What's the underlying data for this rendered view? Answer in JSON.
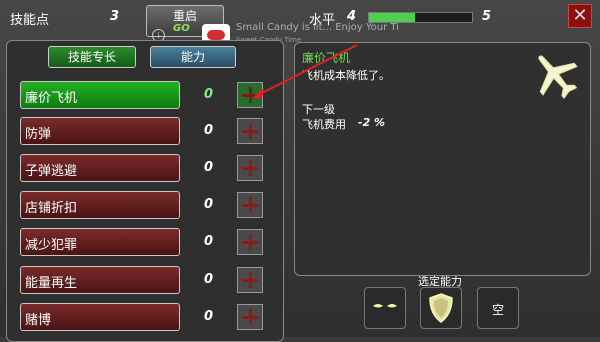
{
  "top": {
    "skill_points_label": "技能点",
    "skill_points": "3",
    "restart": "重启",
    "restart_sub": "GO",
    "level_label": "水平",
    "level": "4",
    "next_level": "5",
    "level_progress": 0.45
  },
  "ad": {
    "title": "Small Candy is lit... Enjoy Your Ti",
    "sub": "Sweet Candy Time",
    "info": "i"
  },
  "tabs": [
    "技能专长",
    "能力"
  ],
  "skills": [
    {
      "name": "廉价飞机",
      "value": "0",
      "selected": true
    },
    {
      "name": "防弹",
      "value": "0"
    },
    {
      "name": "子弹逃避",
      "value": "0"
    },
    {
      "name": "店铺折扣",
      "value": "0"
    },
    {
      "name": "减少犯罪",
      "value": "0"
    },
    {
      "name": "能量再生",
      "value": "0"
    },
    {
      "name": "赌博",
      "value": "0"
    }
  ],
  "detail": {
    "title": "廉价飞机",
    "desc": "飞机成本降低了。",
    "next": "下一级",
    "cost_label": "飞机费用",
    "cost_value": "-2 %"
  },
  "selected": {
    "label": "选定能力",
    "empty": "空"
  },
  "colors": {
    "green": "#1fa81f",
    "red": "#6a1f1f",
    "accent_text": "#6fdc4f"
  }
}
